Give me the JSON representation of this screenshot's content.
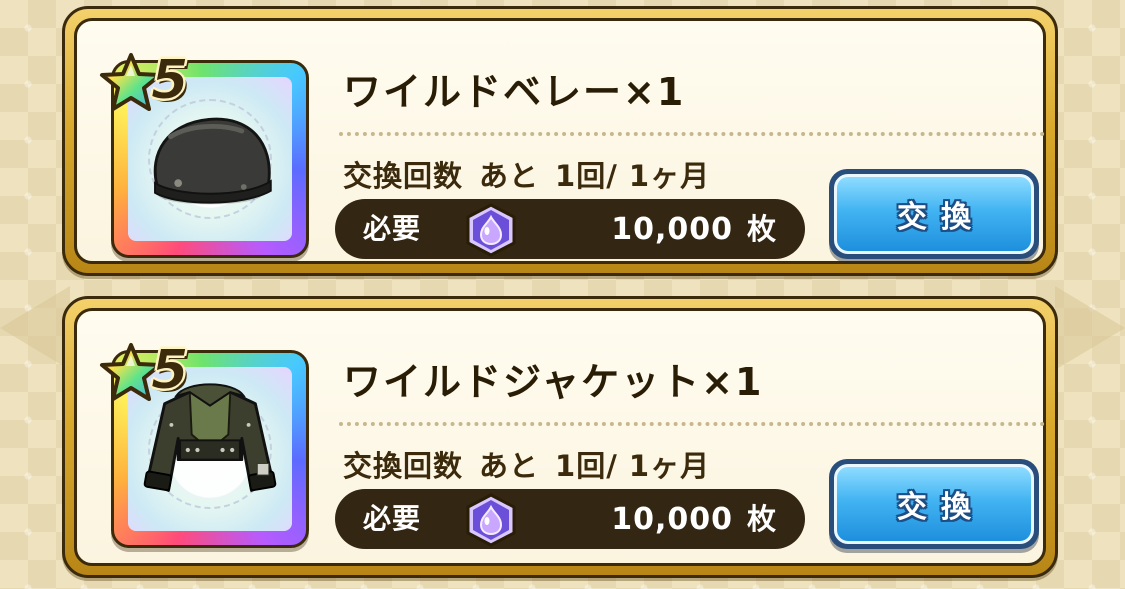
{
  "items": [
    {
      "rarity": "5",
      "icon": "wild-beret-icon",
      "title": "ワイルドベレー×1",
      "limit_label": "交換回数",
      "limit_remaining": "あと",
      "limit_value": "1回/ 1ヶ月",
      "cost_label": "必要",
      "currency_icon": "purple-slime-medal-icon",
      "cost_value": "10,000",
      "cost_unit": "枚",
      "button_label": "交換"
    },
    {
      "rarity": "5",
      "icon": "wild-jacket-icon",
      "title": "ワイルドジャケット×1",
      "limit_label": "交換回数",
      "limit_remaining": "あと",
      "limit_value": "1回/ 1ヶ月",
      "cost_label": "必要",
      "currency_icon": "purple-slime-medal-icon",
      "cost_value": "10,000",
      "cost_unit": "枚",
      "button_label": "交換"
    }
  ],
  "colors": {
    "frame_gold": "#d9a92c",
    "outline": "#3b2a0c",
    "card_bg": "#fbf4df",
    "pill_bg": "#332612",
    "button_blue": "#42b4f2",
    "currency_purple": "#8a5cf0"
  }
}
